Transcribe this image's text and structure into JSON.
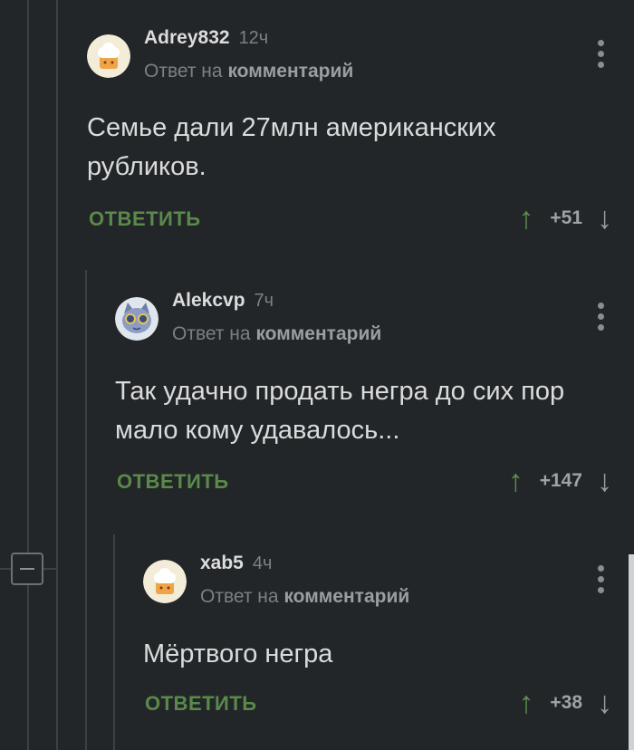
{
  "comments": [
    {
      "author": "Adrey832",
      "time": "12ч",
      "reply_prefix": "Ответ на",
      "reply_link": "комментарий",
      "text": "Семье дали 27млн американских\nрубликов.",
      "reply_label": "ОТВЕТИТЬ",
      "score": "+51",
      "avatar": "chef-hat-avatar"
    },
    {
      "author": "Alekcvp",
      "time": "7ч",
      "reply_prefix": "Ответ на",
      "reply_link": "комментарий",
      "text": "Так удачно продать негра до сих пор\nмало кому удавалось...",
      "reply_label": "ОТВЕТИТЬ",
      "score": "+147",
      "avatar": "cat-with-glasses-avatar"
    },
    {
      "author": "xab5",
      "time": "4ч",
      "reply_prefix": "Ответ на",
      "reply_link": "комментарий",
      "text": "Мёртвого негра",
      "reply_label": "ОТВЕТИТЬ",
      "score": "+38",
      "avatar": "chef-hat-avatar"
    }
  ],
  "icons": {
    "upvote": "arrow-up-icon",
    "downvote": "arrow-down-icon",
    "menu": "more-vertical-icon",
    "collapse": "minus-icon"
  },
  "colors": {
    "background": "#232628",
    "accent_green": "#5a8a4a",
    "muted": "#7c8083"
  }
}
